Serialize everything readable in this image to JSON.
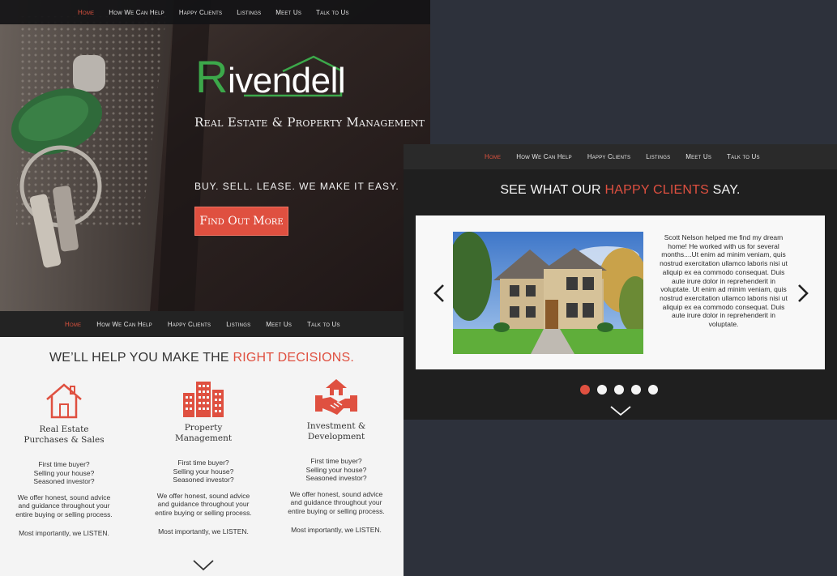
{
  "nav": {
    "items": [
      "Home",
      "How We Can Help",
      "Happy Clients",
      "Listings",
      "Meet Us",
      "Talk to Us"
    ],
    "active_color": "#e0533f"
  },
  "hero": {
    "logo": "Rivendell",
    "tagline": "Real Estate & Property Management",
    "slogan": "BUY. SELL. LEASE. WE MAKE IT EASY.",
    "cta": "Find Out More"
  },
  "services": {
    "title_pre": "WE’LL HELP YOU MAKE THE ",
    "title_hl": "RIGHT DECISIONS.",
    "items": [
      {
        "icon": "house-icon",
        "name_line1": "Real Estate",
        "name_line2": "Purchases & Sales",
        "q1": "First time buyer?",
        "q2": "Selling your house?",
        "q3": "Seasoned investor?",
        "d1": "We offer honest, sound advice",
        "d2": "and guidance throughout your",
        "d3": "entire buying or selling process.",
        "listen": "Most importantly, we LISTEN."
      },
      {
        "icon": "building-icon",
        "name_line1": "Property",
        "name_line2": "Management",
        "q1": "First time buyer?",
        "q2": "Selling your house?",
        "q3": "Seasoned investor?",
        "d1": "We offer honest, sound advice",
        "d2": "and guidance throughout your",
        "d3": "entire buying or selling process.",
        "listen": "Most importantly, we LISTEN."
      },
      {
        "icon": "handshake-house-icon",
        "name_line1": "Investment &",
        "name_line2": "Development",
        "q1": "First time buyer?",
        "q2": "Selling your house?",
        "q3": "Seasoned investor?",
        "d1": "We offer honest, sound advice",
        "d2": "and guidance throughout your",
        "d3": "entire buying or selling process.",
        "listen": "Most importantly, we LISTEN."
      }
    ]
  },
  "clients": {
    "title_pre": "SEE WHAT OUR ",
    "title_hl": "HAPPY CLIENTS",
    "title_post": " SAY.",
    "quote": "Scott Nelson helped me find my dream home! He worked with us for several months....Ut enim ad minim veniam, quis nostrud exercitation ullamco laboris nisi ut aliquip ex ea commodo consequat. Duis aute irure dolor in reprehenderit in voluptate. Ut enim ad minim veniam, quis nostrud exercitation ullamco laboris nisi ut aliquip ex ea commodo consequat. Duis aute irure dolor in reprehenderit in voluptate.",
    "dots": 5,
    "active_dot": 1
  },
  "colors": {
    "accent": "#df5040",
    "logo_green": "#3ca84a"
  }
}
